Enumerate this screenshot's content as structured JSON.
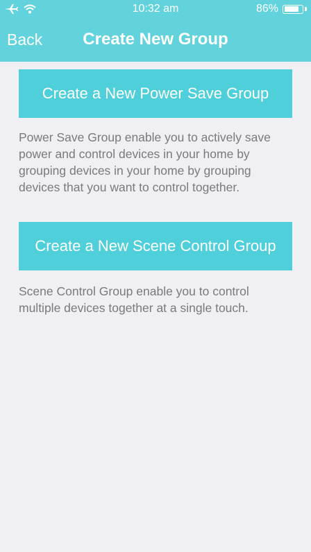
{
  "status_bar": {
    "airplane_icon": "airplane-icon",
    "wifi_icon": "wifi-icon",
    "time": "10:32 am",
    "battery": "86%",
    "battery_level": 0.86
  },
  "nav": {
    "back_label": "Back",
    "title": "Create New Group"
  },
  "power_save": {
    "button_label": "Create a New Power Save Group",
    "description": "Power Save Group enable you to actively save power and control devices in your home  by grouping devices in your home by grouping devices that you want to control together."
  },
  "scene_control": {
    "button_label": "Create a New Scene Control Group",
    "description": "Scene Control Group enable you to control multiple devices together at a single touch."
  },
  "colors": {
    "header": "#62d3dc",
    "button": "#4fcfd9",
    "background": "#efeff4",
    "description_text": "#7a7a7a"
  }
}
